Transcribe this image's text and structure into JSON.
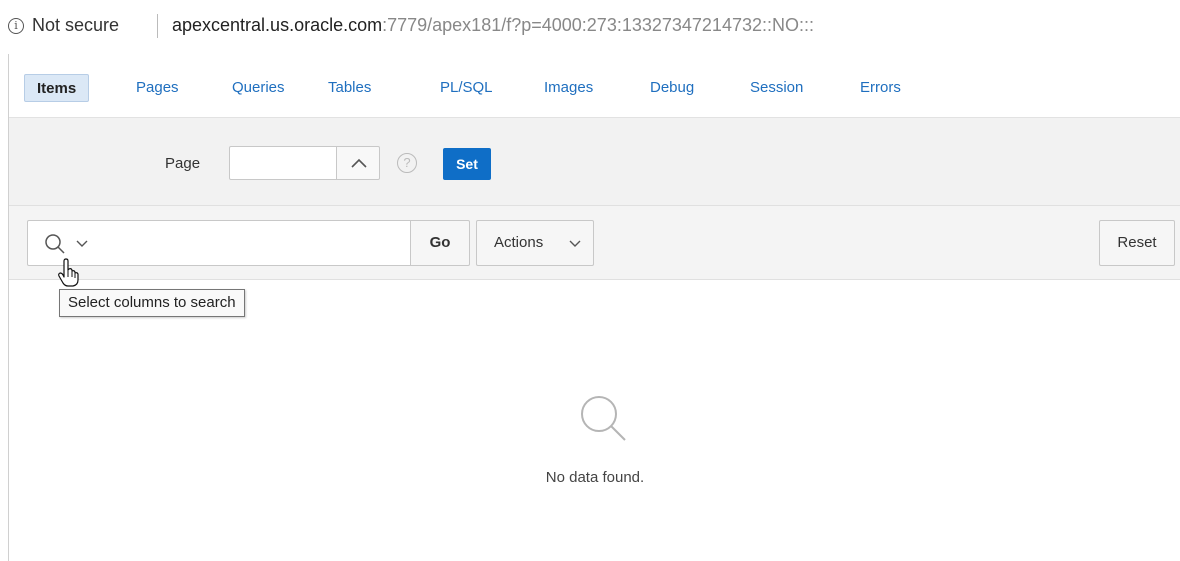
{
  "address_bar": {
    "info_icon": "info-circle-icon",
    "security_text": "Not secure",
    "url_host": "apexcentral.us.oracle.com",
    "url_rest": ":7779/apex181/f?p=4000:273:13327347214732::NO:::"
  },
  "tabs": [
    {
      "label": "Items",
      "active": true
    },
    {
      "label": "Pages",
      "active": false
    },
    {
      "label": "Queries",
      "active": false
    },
    {
      "label": "Tables",
      "active": false
    },
    {
      "label": "PL/SQL",
      "active": false
    },
    {
      "label": "Images",
      "active": false
    },
    {
      "label": "Debug",
      "active": false
    },
    {
      "label": "Session",
      "active": false
    },
    {
      "label": "Errors",
      "active": false
    }
  ],
  "page_form": {
    "label": "Page",
    "value": "",
    "help_icon": "question-circle-icon",
    "up_icon": "chevron-up-icon",
    "set_label": "Set"
  },
  "toolbar": {
    "search_icon": "search-icon",
    "search_value": "",
    "go_label": "Go",
    "actions_label": "Actions",
    "reset_label": "Reset"
  },
  "tooltip": {
    "text": "Select columns to search"
  },
  "empty_state": {
    "icon": "search-icon",
    "message": "No data found."
  },
  "colors": {
    "tab_link": "#1f6fbf",
    "tab_active_bg": "#dbe8f6",
    "set_button": "#0f6ec7",
    "region_bg": "#f2f2f2"
  }
}
